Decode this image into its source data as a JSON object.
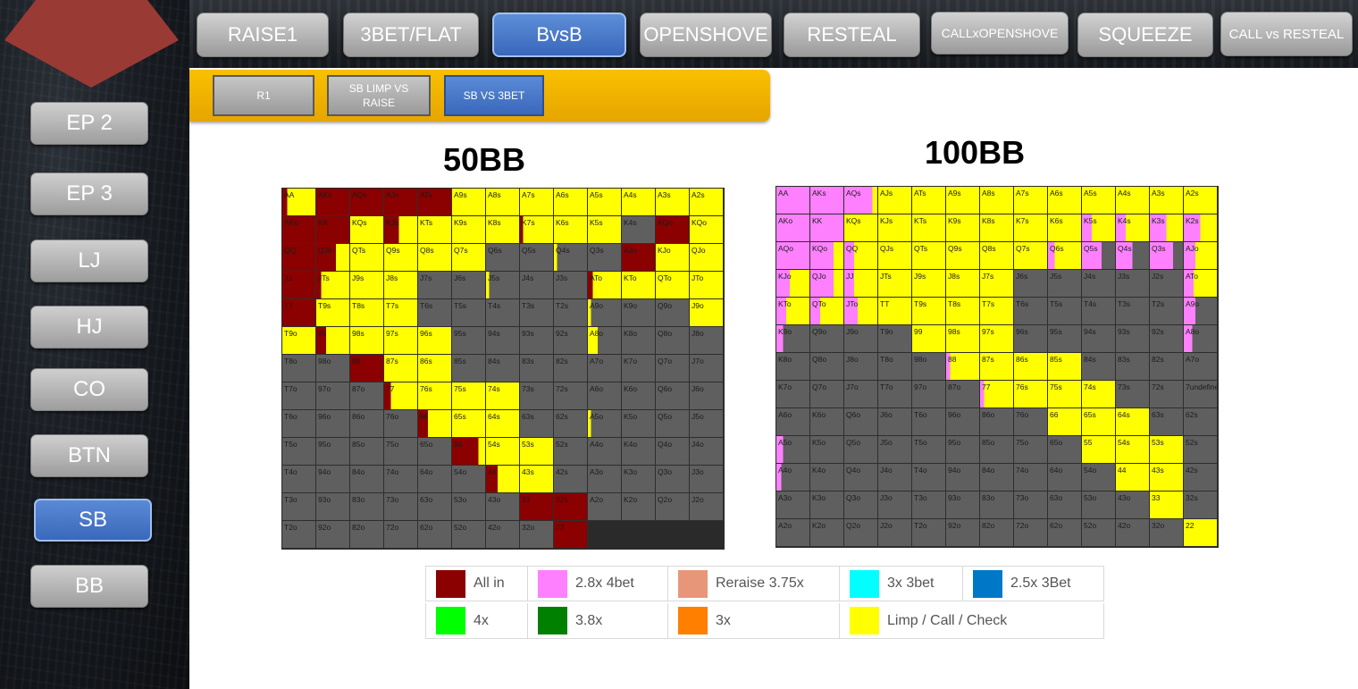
{
  "sidebar": {
    "items": [
      {
        "label": "EP 2"
      },
      {
        "label": "EP 3"
      },
      {
        "label": "LJ"
      },
      {
        "label": "HJ"
      },
      {
        "label": "CO"
      },
      {
        "label": "BTN"
      },
      {
        "label": "SB",
        "active": true
      },
      {
        "label": "BB"
      }
    ]
  },
  "top_tabs": [
    {
      "label": "RAISE1"
    },
    {
      "label": "3BET/FLAT"
    },
    {
      "label": "BvsB",
      "active": true
    },
    {
      "label": "OPENSHOVE"
    },
    {
      "label": "RESTEAL"
    },
    {
      "label": "CALLxOPENSHOVE"
    },
    {
      "label": "SQUEEZE"
    },
    {
      "label": "CALL vs RESTEAL"
    }
  ],
  "sub_tabs": [
    {
      "label": "R1"
    },
    {
      "label": "SB LIMP VS RAISE"
    },
    {
      "label": "SB VS 3BET",
      "active": true
    }
  ],
  "colors": {
    "allin": "#8b0000",
    "bet4": "#ff80ff",
    "reraise": "#e8967a",
    "bet3x": "#00ffff",
    "bet25": "#0078c8",
    "x4": "#00ff00",
    "x38": "#008000",
    "x3": "#ff7f00",
    "call": "#ffff00",
    "fold": "#5f5f5f"
  },
  "ranks": [
    "A",
    "K",
    "Q",
    "J",
    "T",
    "9",
    "8",
    "7",
    "6",
    "5",
    "4",
    "3",
    "2"
  ],
  "charts": [
    {
      "title": "50BB",
      "rows": [
        "Y;AA Y;AKs Y;AQs Y;AJs Y;ATs Y Y Y Y Y Y Y Y",
        "A A Y Y;KTs Y Y Y G;K5s Y Y G",
        "A Y A Y;QJs Y Y Y Y G G G;Q3s G",
        "A Y Y A Y;JTs Y Y G G G;J4s G G",
        "Y;ATo Y Y Y A Y Y Y G G G G G",
        "G;A9o G G Y Y A;99 Y Y Y G G G G",
        "G;A8o G G G G G A Y Y G G G G",
        "G G G G G G G G;77 Y Y Y G G",
        "G G G G G G G G A;66 Y Y G G",
        "G;A5o G G G G G G G G A;55 Y Y G",
        "G G G G G G G G G G A;44 Y G",
        "G G G G G G G G G G G A A",
        "G G G G G G G G G G G G A"
      ],
      "split": {
        "AA": {
          "a": 15,
          "b": "A",
          "c": "Y"
        },
        "AKs": {
          "a": 100,
          "b": "A"
        },
        "AQs": {
          "a": 100,
          "b": "A"
        },
        "AJs": {
          "a": 100,
          "b": "A"
        },
        "ATs": {
          "a": 100,
          "b": "A"
        },
        "KTs": {
          "a": 45,
          "b": "A",
          "c": "Y"
        },
        "K5s": {
          "a": 10,
          "b": "A",
          "c": "Y"
        },
        "QJs": {
          "a": 60,
          "b": "A",
          "c": "Y"
        },
        "Q3s": {
          "a": 10,
          "b": "Y",
          "c": "G"
        },
        "JTs": {
          "a": 15,
          "b": "A",
          "c": "Y"
        },
        "J4s": {
          "a": 10,
          "b": "Y",
          "c": "G"
        },
        "ATo": {
          "a": 15,
          "b": "A",
          "c": "Y"
        },
        "A9o": {
          "a": 10,
          "b": "Y",
          "c": "G"
        },
        "A8o": {
          "a": 30,
          "b": "Y",
          "c": "G"
        },
        "A5o": {
          "a": 10,
          "b": "Y",
          "c": "G"
        },
        "99": {
          "a": 30,
          "b": "A",
          "c": "Y"
        },
        "77": {
          "a": 20,
          "b": "A",
          "c": "Y"
        },
        "66": {
          "a": 30,
          "b": "A",
          "c": "Y"
        },
        "55": {
          "a": 80,
          "b": "A",
          "c": "Y"
        },
        "44": {
          "a": 35,
          "b": "A",
          "c": "Y"
        }
      }
    },
    {
      "title": "100BB",
      "rows": [
        "P P P;AQs Y Y Y Y Y Y Y Y Y Y",
        "P;AKo P Y Y Y Y Y Y Y Y;K5s Y;K4s Y;K3s Y;K2s",
        "P;AQo P;KQo P;QQ Y Y Y Y Y Y;Q6s Y;Q5s G;Q4s G;Q2s",
        "P;AJo P;KJo P;QJo P;JJ Y Y Y Y G G G G G",
        "P;ATo P;KTo P;QTo P;JTo Y Y Y Y G G G G G",
        "P;A9o P;K9o G G G Y Y Y G G G G G",
        "P;A8o G G G G G Y;88 Y Y Y G G G",
        "G G G G G G G P;77 Y Y Y G G G",
        "G G G G G G G G Y Y Y G G",
        "P;A5o G G G G G G G G Y Y Y G",
        "P;A4o G G G G G G G G G Y Y G",
        "G G G G G G G G G G G Y G",
        "G G G G G G G G G G G G Y"
      ],
      "split": {
        "AQs": {
          "a": 85,
          "b": "P",
          "c": "Y"
        },
        "AKo": {
          "a": 100,
          "b": "P"
        },
        "KQo": {
          "a": 70,
          "b": "P",
          "c": "Y"
        },
        "QQ": {
          "a": 30,
          "b": "P",
          "c": "Y"
        },
        "K5s": {
          "a": 30,
          "b": "P",
          "c": "Y"
        },
        "K4s": {
          "a": 30,
          "b": "P",
          "c": "Y"
        },
        "K3s": {
          "a": 50,
          "b": "P",
          "c": "Y"
        },
        "K2s": {
          "a": 50,
          "b": "P",
          "c": "Y"
        },
        "Q6s": {
          "a": 20,
          "b": "P",
          "c": "Y"
        },
        "Q5s": {
          "a": 60,
          "b": "P",
          "c": "G"
        },
        "Q4s": {
          "a": 50,
          "b": "P",
          "c": "G"
        },
        "Q2s": {
          "a": 70,
          "b": "P",
          "c": "G"
        },
        "AJo": {
          "a": 35,
          "b": "P",
          "c": "Y"
        },
        "KJo": {
          "a": 40,
          "b": "P",
          "c": "Y"
        },
        "QJo": {
          "a": 70,
          "b": "P",
          "c": "Y"
        },
        "JJ": {
          "a": 30,
          "b": "P",
          "c": "Y"
        },
        "ATo": {
          "a": 30,
          "b": "P",
          "c": "Y"
        },
        "KTo": {
          "a": 30,
          "b": "P",
          "c": "Y"
        },
        "QTo": {
          "a": 30,
          "b": "P",
          "c": "Y"
        },
        "JTo": {
          "a": 40,
          "b": "P",
          "c": "Y"
        },
        "A9o": {
          "a": 35,
          "b": "P",
          "c": "G"
        },
        "K9o": {
          "a": 20,
          "b": "P",
          "c": "G"
        },
        "88": {
          "a": 12,
          "b": "P",
          "c": "Y"
        },
        "77": {
          "a": 12,
          "b": "P",
          "c": "Y"
        },
        "A8o": {
          "a": 25,
          "b": "P",
          "c": "G"
        },
        "A5o": {
          "a": 20,
          "b": "P",
          "c": "G"
        },
        "A4o": {
          "a": 15,
          "b": "P",
          "c": "G"
        }
      }
    }
  ],
  "legend": [
    {
      "label": "All in",
      "color": "#8b0000"
    },
    {
      "label": "2.8x 4bet",
      "color": "#ff80ff"
    },
    {
      "label": "Reraise 3.75x",
      "color": "#e8967a"
    },
    {
      "label": "3x 3bet",
      "color": "#00ffff"
    },
    {
      "label": "2.5x 3Bet",
      "color": "#0078c8"
    },
    {
      "label": "4x",
      "color": "#00ff00"
    },
    {
      "label": "3.8x",
      "color": "#008000"
    },
    {
      "label": "3x",
      "color": "#ff7f00"
    },
    {
      "label": "Limp / Call / Check",
      "color": "#ffff00"
    }
  ]
}
